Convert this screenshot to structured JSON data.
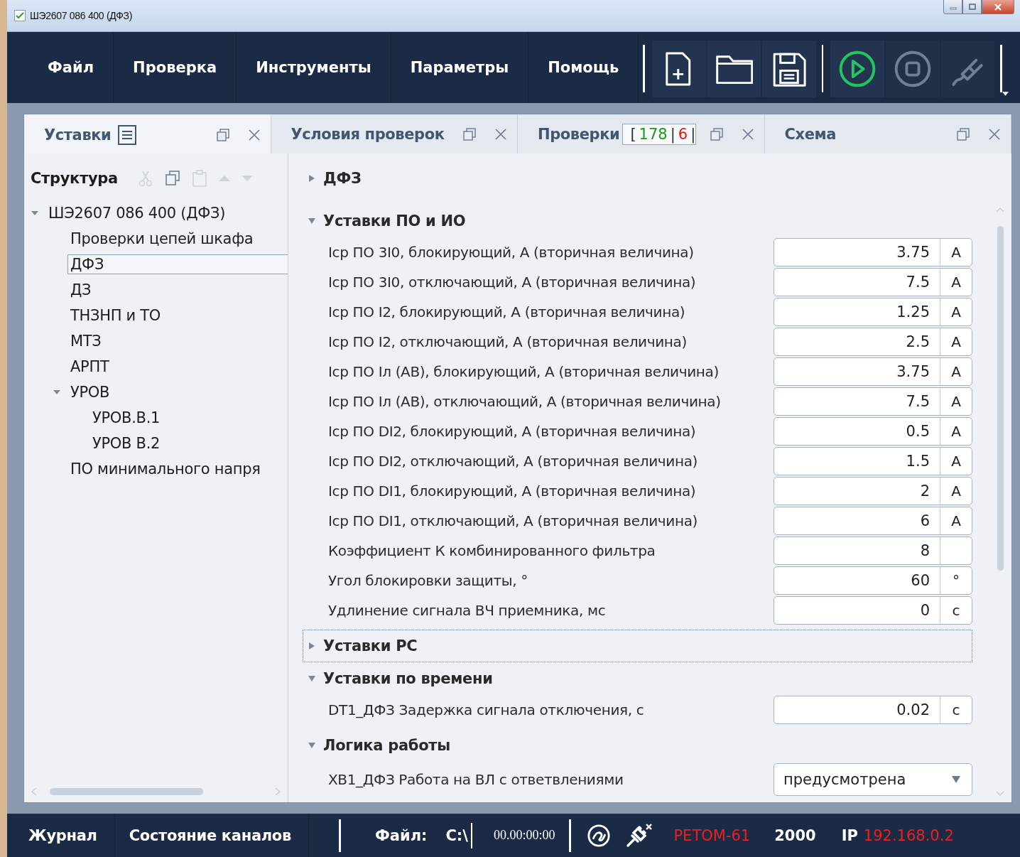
{
  "window": {
    "title": "ШЭ2607 086 400 (ДФЗ)",
    "checked": true
  },
  "menu": [
    "Файл",
    "Проверка",
    "Инструменты",
    "Параметры",
    "Помощь"
  ],
  "toolbar": {
    "file_tools": [
      {
        "kind": "new"
      },
      {
        "kind": "open"
      },
      {
        "kind": "save"
      }
    ],
    "run_tools": [
      {
        "kind": "play",
        "disabled": false
      },
      {
        "kind": "stop",
        "disabled": true
      },
      {
        "kind": "plug",
        "disabled": true
      }
    ]
  },
  "tabs": [
    {
      "label": "Уставки",
      "selected": true,
      "kind": "settings"
    },
    {
      "label": "Условия проверок",
      "selected": false,
      "kind": "plain"
    },
    {
      "label": "Проверки",
      "selected": false,
      "kind": "checks",
      "counter": [
        {
          "text": "[",
          "kind": "bracket"
        },
        {
          "text": "178",
          "kind": "passed"
        },
        {
          "text": "|",
          "kind": "separator"
        },
        {
          "text": "6",
          "kind": "failed"
        },
        {
          "text": "|",
          "kind": "separator"
        }
      ]
    },
    {
      "label": "Схема",
      "selected": false,
      "kind": "plain"
    }
  ],
  "tree": {
    "title": "Структура",
    "tools": [
      {
        "kind": "cut",
        "disabled": true
      },
      {
        "kind": "copy",
        "disabled": false
      },
      {
        "kind": "paste",
        "disabled": true
      },
      {
        "kind": "up",
        "disabled": true
      },
      {
        "kind": "down",
        "disabled": true
      }
    ],
    "items": [
      {
        "label": "ШЭ2607 086 400 (ДФЗ)",
        "selected": false,
        "expanded": true,
        "children": [
          {
            "label": "Проверки цепей шкафа",
            "selected": false
          },
          {
            "label": "ДФЗ",
            "selected": true
          },
          {
            "label": "ДЗ",
            "selected": false
          },
          {
            "label": "ТНЗНП и ТО",
            "selected": false
          },
          {
            "label": "МТЗ",
            "selected": false
          },
          {
            "label": "АРПТ",
            "selected": false
          },
          {
            "label": "УРОВ",
            "selected": false,
            "expanded": true,
            "children": [
              {
                "label": "УРОВ.В.1",
                "selected": false
              },
              {
                "label": "УРОВ В.2",
                "selected": false
              }
            ]
          },
          {
            "label": "ПО минимального напря",
            "selected": false
          }
        ]
      }
    ]
  },
  "sections": [
    {
      "title": "ДФЗ",
      "expanded": false,
      "focused": false
    },
    {
      "title": "Уставки ПО и ИО",
      "expanded": true,
      "focused": false,
      "rows": [
        {
          "kind": "number",
          "label": "Iср ПО 3I0, блокирующий, А (вторичная величина)",
          "value": "3.75",
          "unit": "А"
        },
        {
          "kind": "number",
          "label": "Iср ПО 3I0, отключающий, А (вторичная величина)",
          "value": "7.5",
          "unit": "А"
        },
        {
          "kind": "number",
          "label": "Iср ПО I2, блокирующий, А (вторичная величина)",
          "value": "1.25",
          "unit": "А"
        },
        {
          "kind": "number",
          "label": "Iср ПО I2, отключающий, А (вторичная величина)",
          "value": "2.5",
          "unit": "А"
        },
        {
          "kind": "number",
          "label": "Iср ПО Iл (АВ), блокирующий, А (вторичная величина)",
          "value": "3.75",
          "unit": "А"
        },
        {
          "kind": "number",
          "label": "Iср ПО Iл (АВ), отключающий, А (вторичная величина)",
          "value": "7.5",
          "unit": "А"
        },
        {
          "kind": "number",
          "label": "Iср ПО DI2, блокирующий, А (вторичная величина)",
          "value": "0.5",
          "unit": "А"
        },
        {
          "kind": "number",
          "label": "Iср ПО DI2, отключающий, А (вторичная величина)",
          "value": "1.5",
          "unit": "А"
        },
        {
          "kind": "number",
          "label": "Iср ПО DI1, блокирующий, А (вторичная величина)",
          "value": "2",
          "unit": "А"
        },
        {
          "kind": "number",
          "label": "Iср ПО DI1, отключающий, А (вторичная величина)",
          "value": "6",
          "unit": "А"
        },
        {
          "kind": "number",
          "label": "Коэффициент К комбинированного фильтра",
          "value": "8"
        },
        {
          "kind": "number",
          "label": "Угол блокировки защиты, °",
          "value": "60",
          "unit": "°"
        },
        {
          "kind": "number",
          "label": "Удлинение сигнала ВЧ приемника, мс",
          "value": "0",
          "unit": "с"
        }
      ]
    },
    {
      "title": "Уставки РС",
      "expanded": false,
      "focused": true
    },
    {
      "title": "Уставки по времени",
      "expanded": true,
      "focused": false,
      "rows": [
        {
          "kind": "number",
          "label": "DT1_ДФЗ Задержка сигнала отключения, с",
          "value": "0.02",
          "unit": "с"
        }
      ]
    },
    {
      "title": "Логика работы",
      "expanded": true,
      "focused": false,
      "rows": [
        {
          "kind": "select",
          "label": "XB1_ДФЗ Работа на ВЛ с ответвлениями",
          "value": "предусмотрена"
        }
      ]
    }
  ],
  "status_bar": {
    "items": [
      "Журнал",
      "Состояние каналов"
    ],
    "file_label": "Файл:",
    "file_path": "C:\\",
    "time": "00.00:00:00",
    "device": {
      "name": "РЕТОМ-61",
      "connected": false
    },
    "port": "2000",
    "ip_label": "IP",
    "ip": "192.168.0.2"
  }
}
